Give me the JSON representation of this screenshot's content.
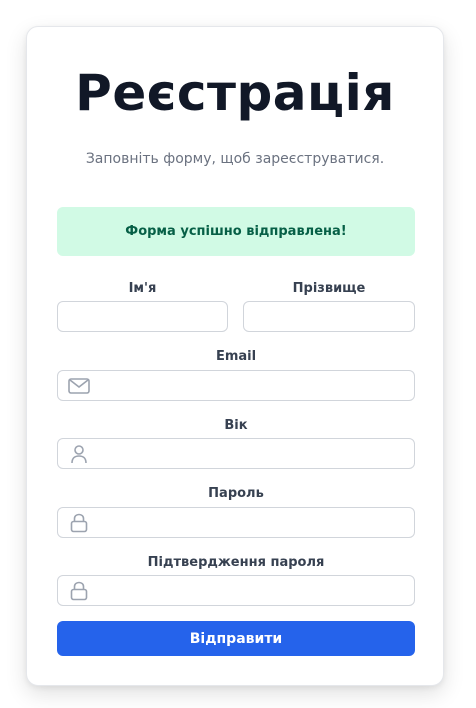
{
  "form": {
    "title": "Реєстрація",
    "subtitle": "Заповніть форму, щоб зареєструватися.",
    "success_message": "Форма успішно відправлена!",
    "fields": {
      "first_name": {
        "label": "Ім'я",
        "value": ""
      },
      "last_name": {
        "label": "Прізвище",
        "value": ""
      },
      "email": {
        "label": "Email",
        "value": "",
        "icon": "envelope-icon"
      },
      "age": {
        "label": "Вік",
        "value": "",
        "icon": "user-icon"
      },
      "password": {
        "label": "Пароль",
        "value": "",
        "icon": "lock-icon"
      },
      "confirm_password": {
        "label": "Підтвердження пароля",
        "value": "",
        "icon": "lock-icon"
      }
    },
    "submit_label": "Відправити"
  },
  "colors": {
    "accent": "#2563eb",
    "success_bg": "#d1fae5",
    "success_text": "#065f46",
    "title": "#111827",
    "muted": "#6b7280"
  }
}
